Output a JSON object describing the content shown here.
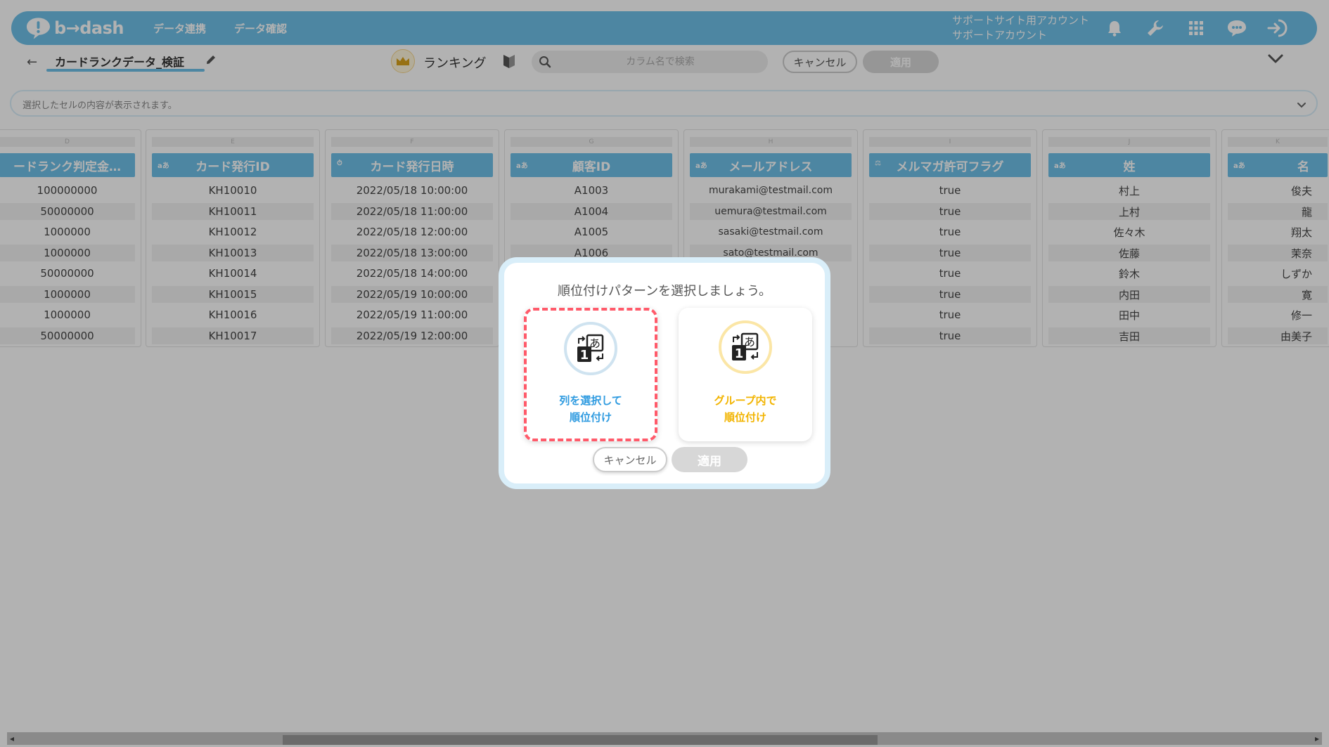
{
  "header": {
    "logo_text": "b→dash",
    "nav": [
      "データ連携",
      "データ確認"
    ],
    "account_line1": "サポートサイト用アカウント",
    "account_line2": "サポートアカウント",
    "icons": [
      "bell-icon",
      "wrench-icon",
      "apps-grid-icon",
      "chat-icon",
      "logout-icon"
    ]
  },
  "toolbar": {
    "dataset_name": "カードランクデータ_検証",
    "mode_label": "ランキング",
    "search_placeholder": "カラム名で検索",
    "cancel_label": "キャンセル",
    "apply_label": "適用"
  },
  "cell_viewer": {
    "placeholder": "選択したセルの内容が表示されます。"
  },
  "grid": {
    "columns": [
      {
        "letter": "D",
        "type": "",
        "header": "ードランク判定金…",
        "cells": [
          "100000000",
          "50000000",
          "1000000",
          "1000000",
          "50000000",
          "1000000",
          "1000000",
          "50000000"
        ]
      },
      {
        "letter": "E",
        "type": "aあ",
        "header": "カード発行ID",
        "cells": [
          "KH10010",
          "KH10011",
          "KH10012",
          "KH10013",
          "KH10014",
          "KH10015",
          "KH10016",
          "KH10017"
        ]
      },
      {
        "letter": "F",
        "type": "⏱",
        "header": "カード発行日時",
        "cells": [
          "2022/05/18 10:00:00",
          "2022/05/18 11:00:00",
          "2022/05/18 12:00:00",
          "2022/05/18 13:00:00",
          "2022/05/18 14:00:00",
          "2022/05/19 10:00:00",
          "2022/05/19 11:00:00",
          "2022/05/19 12:00:00"
        ]
      },
      {
        "letter": "G",
        "type": "aあ",
        "header": "顧客ID",
        "cells": [
          "A1003",
          "A1004",
          "A1005",
          "A1006",
          "",
          "",
          "",
          ""
        ]
      },
      {
        "letter": "H",
        "type": "aあ",
        "header": "メールアドレス",
        "cells": [
          "murakami@testmail.com",
          "uemura@testmail.com",
          "sasaki@testmail.com",
          "sato@testmail.com",
          "",
          "",
          "",
          ""
        ]
      },
      {
        "letter": "I",
        "type": "⚖",
        "header": "メルマガ許可フラグ",
        "cells": [
          "true",
          "true",
          "true",
          "true",
          "true",
          "true",
          "true",
          "true"
        ]
      },
      {
        "letter": "J",
        "type": "aあ",
        "header": "姓",
        "cells": [
          "村上",
          "上村",
          "佐々木",
          "佐藤",
          "鈴木",
          "内田",
          "田中",
          "吉田"
        ]
      },
      {
        "letter": "K",
        "type": "aあ",
        "header": "名",
        "cells": [
          "俊夫",
          "龍",
          "翔太",
          "茉奈",
          "しずか",
          "寛",
          "修一",
          "由美子"
        ]
      }
    ]
  },
  "modal": {
    "title": "順位付けパターンを選択しましょう。",
    "options": [
      {
        "line1": "列を選択して",
        "line2": "順位付け",
        "color": "#2f9be0"
      },
      {
        "line1": "グループ内で",
        "line2": "順位付け",
        "color": "#f2b400"
      }
    ],
    "cancel_label": "キャンセル",
    "apply_label": "適用"
  },
  "colors": {
    "brand": "#6fc0e8",
    "highlight": "#ff5a6a"
  }
}
